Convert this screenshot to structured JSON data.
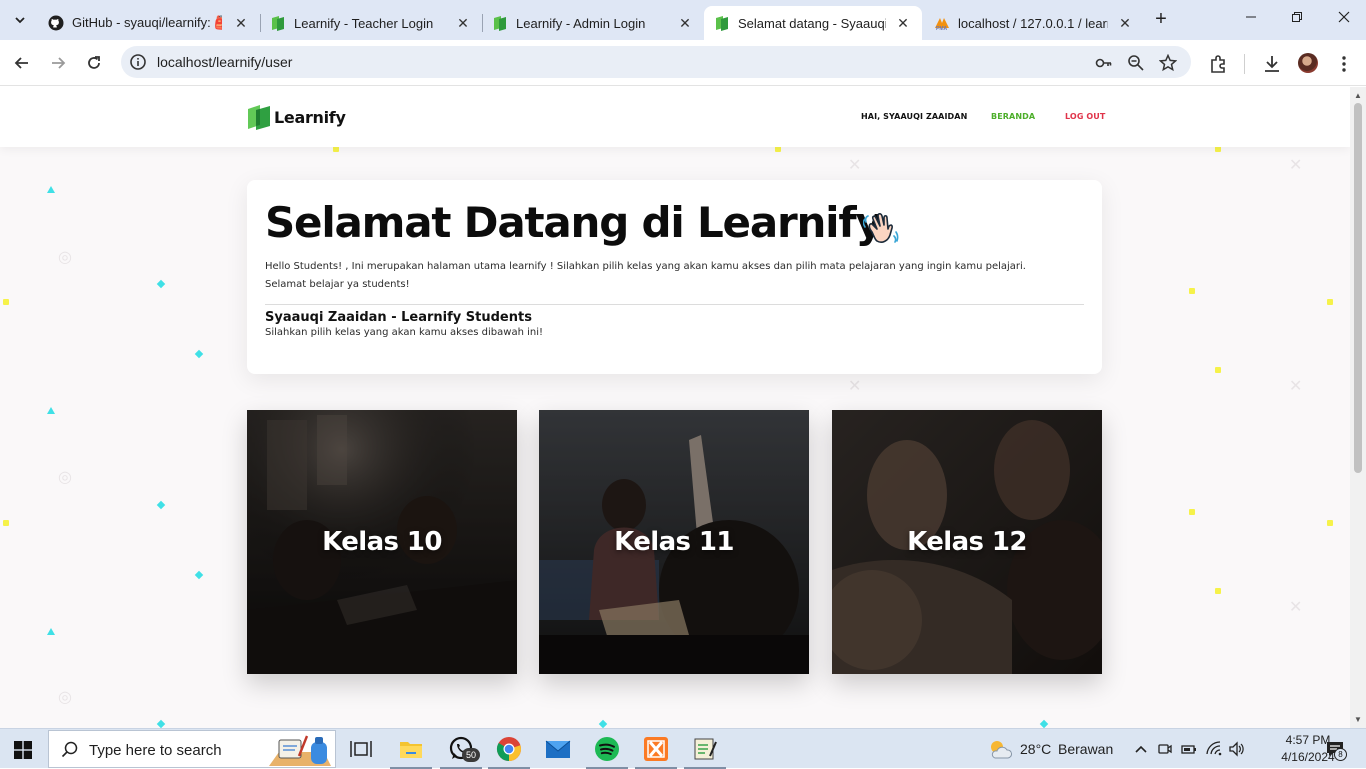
{
  "browser": {
    "tabs": [
      {
        "title": "GitHub - syauqi/learnify: 🎒",
        "favicon": "github-icon",
        "active": false
      },
      {
        "title": "Learnify - Teacher Login",
        "favicon": "learnify-icon",
        "active": false
      },
      {
        "title": "Learnify - Admin Login",
        "favicon": "learnify-icon",
        "active": false
      },
      {
        "title": "Selamat datang - Syaauqi Zaaidan",
        "favicon": "learnify-icon",
        "active": true
      },
      {
        "title": "localhost / 127.0.0.1 / learnify",
        "favicon": "phpmyadmin-icon",
        "active": false
      }
    ],
    "url": "localhost/learnify/user"
  },
  "site": {
    "logo_text": "Learnify",
    "nav": {
      "greeting": "HAI, SYAAUQI ZAAIDAN",
      "home": "BERANDA",
      "logout": "LOG OUT"
    },
    "colors": {
      "home": "#4cae2a",
      "logout": "#e0344a",
      "logo_green": "#3fb34f"
    }
  },
  "welcome": {
    "title": "Selamat Datang di Learnify",
    "emoji": "waving-hand",
    "intro_line1": "Hello Students! , Ini merupakan halaman utama learnify ! Silahkan pilih kelas yang akan kamu akses dan pilih mata pelajaran yang ingin kamu pelajari.",
    "intro_line2": "Selamat belajar ya students!",
    "name": "Syaauqi Zaaidan - Learnify Students",
    "subtitle": "Silahkan pilih kelas yang akan kamu akses dibawah ini!"
  },
  "classes": [
    {
      "label": "Kelas 10"
    },
    {
      "label": "Kelas 11"
    },
    {
      "label": "Kelas 12"
    }
  ],
  "taskbar": {
    "search_placeholder": "Type here to search",
    "whatsapp_badge": "50",
    "weather_temp": "28°C",
    "weather_text": "Berawan",
    "time": "4:57 PM",
    "date": "4/16/2024",
    "notifications": "8"
  }
}
